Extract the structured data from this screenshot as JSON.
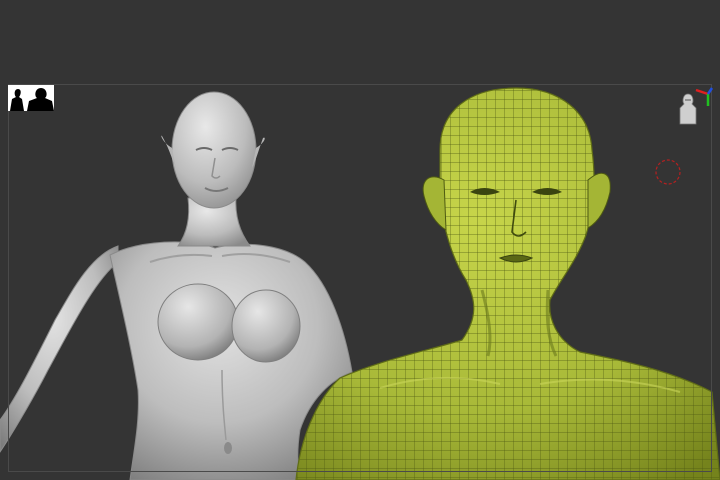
{
  "viewport": {
    "background_color": "#343434",
    "frame_color": "#4a4a4a"
  },
  "toolbar_icons": {
    "floor": "floor-silhouettes-icon",
    "gizmo": "axis-gizmo-icon",
    "cursor": "rotate-cursor-icon"
  },
  "models": {
    "left": {
      "description_icon": "matcap-grey-female-figure",
      "material_color": "#c9c9c9"
    },
    "right": {
      "description_icon": "polyframe-green-female-bust",
      "material_color": "#a9bb3a",
      "wire_color": "#4e5a12"
    }
  },
  "axis_colors": {
    "x": "#e02020",
    "y": "#20c020",
    "z": "#2050e0"
  }
}
